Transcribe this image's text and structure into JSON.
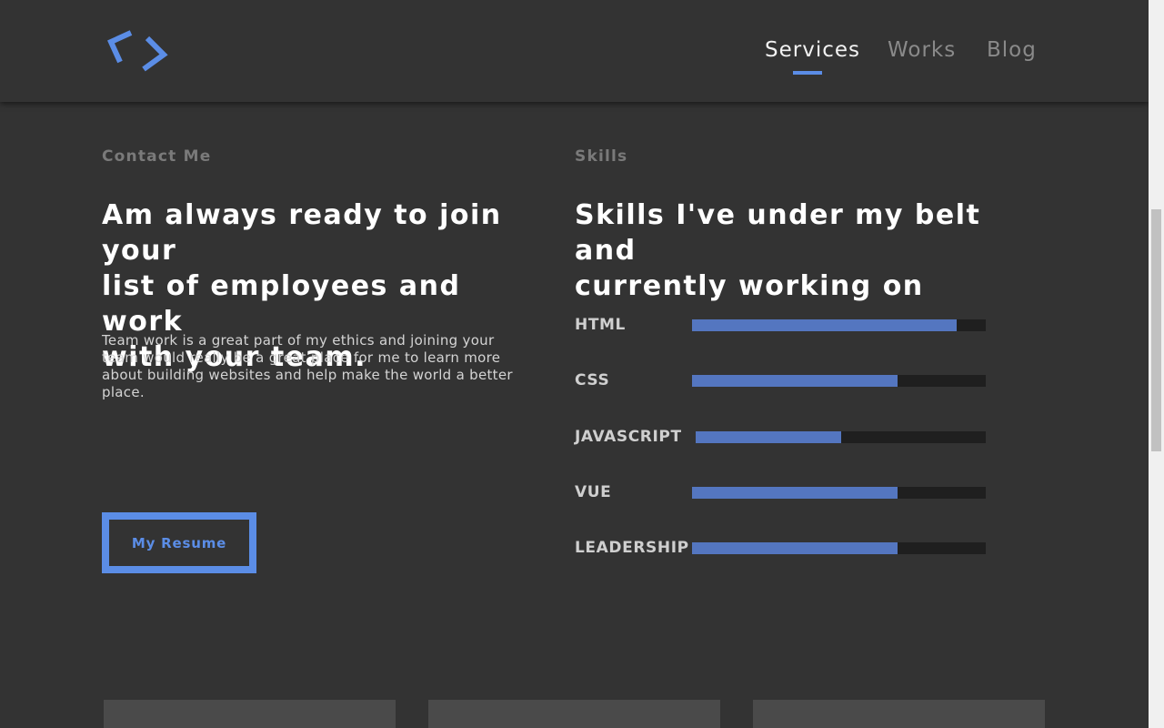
{
  "header": {
    "logo_icon": "code-brackets-icon",
    "nav": [
      {
        "label": "Services",
        "active": true
      },
      {
        "label": "Works",
        "active": false
      },
      {
        "label": "Blog",
        "active": false
      }
    ]
  },
  "contact": {
    "eyebrow": "Contact Me",
    "headline_lines": [
      "Am always ready to join your",
      "list of employees and work",
      "with your team."
    ],
    "body": "Team work is a great part of my ethics and joining your team would really be a great place for me to learn more about building websites and help make the world a better place.",
    "button_label": "My Resume"
  },
  "skills": {
    "eyebrow": "Skills",
    "headline_lines": [
      "Skills I've under my belt and",
      "currently working on"
    ],
    "items": [
      {
        "label": "HTML",
        "level": 0.9
      },
      {
        "label": "CSS",
        "level": 0.7
      },
      {
        "label": "JAVASCRIPT",
        "level": 0.5
      },
      {
        "label": "VUE",
        "level": 0.7
      },
      {
        "label": "LEADERSHIP",
        "level": 0.7
      }
    ]
  },
  "colors": {
    "accent": "#5b8de6",
    "bar_fill": "#5476c0",
    "bar_track": "#1f1f1f",
    "background": "#333333"
  }
}
